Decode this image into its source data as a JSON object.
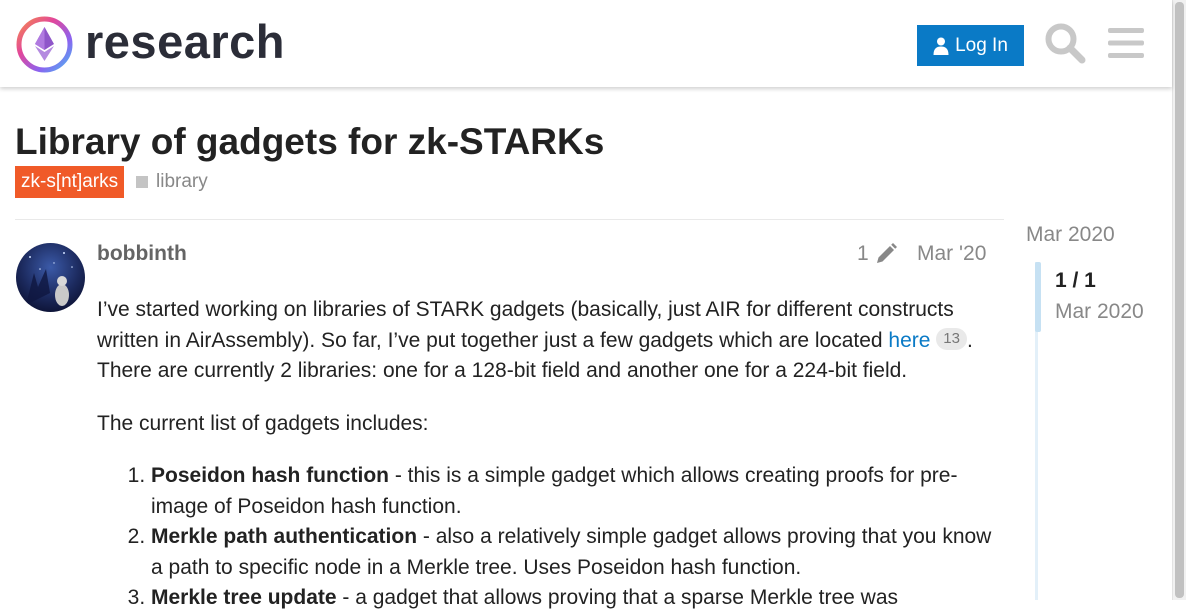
{
  "header": {
    "logo_text": "research",
    "login_label": "Log In",
    "icons": {
      "login": "user-icon",
      "search": "search-icon",
      "menu": "hamburger-menu-icon"
    }
  },
  "topic": {
    "title": "Library of gadgets for zk-STARKs",
    "category": "zk-s[nt]arks",
    "tag": "library"
  },
  "post": {
    "username": "bobbinth",
    "edit_count": "1",
    "date": "Mar '20",
    "p1_text_a": "I’ve started working on libraries of STARK gadgets (basically, just AIR for different constructs written in AirAssembly). So far, I’ve put together just a few gadgets which are located ",
    "p1_link": "here",
    "p1_link_clicks": "13",
    "p1_text_b": ". There are currently 2 libraries: one for a 128-bit field and another one for a 224-bit field.",
    "p2": "The current list of gadgets includes:",
    "list": [
      {
        "title": "Poseidon hash function",
        "desc": " - this is a simple gadget which allows creating proofs for pre-image of Poseidon hash function."
      },
      {
        "title": "Merkle path authentication",
        "desc": " - also a relatively simple gadget allows proving that you know a path to specific node in a Merkle tree. Uses Poseidon hash function."
      },
      {
        "title": "Merkle tree update",
        "desc": " - a gadget that allows proving that a sparse Merkle tree was"
      }
    ]
  },
  "timeline": {
    "start_date": "Mar 2020",
    "position": "1 / 1",
    "position_date": "Mar 2020"
  },
  "colors": {
    "accent": "#0a7ac6",
    "category": "#f05a28"
  }
}
